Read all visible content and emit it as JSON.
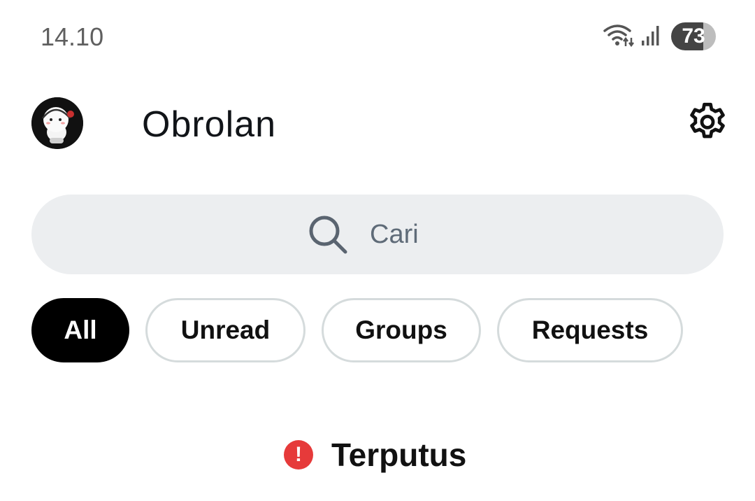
{
  "status_bar": {
    "time": "14.10",
    "battery_level": "73",
    "icons": [
      "wifi-icon",
      "signal-icon",
      "battery-icon"
    ]
  },
  "header": {
    "title": "Obrolan",
    "avatar_icon": "avatar",
    "settings_icon": "gear-icon"
  },
  "search": {
    "placeholder": "Cari",
    "value": ""
  },
  "filters": [
    {
      "label": "All",
      "active": true
    },
    {
      "label": "Unread",
      "active": false
    },
    {
      "label": "Groups",
      "active": false
    },
    {
      "label": "Requests",
      "active": false
    }
  ],
  "connection": {
    "status_text": "Terputus",
    "icon": "alert-icon",
    "color": "#e63a3a"
  }
}
